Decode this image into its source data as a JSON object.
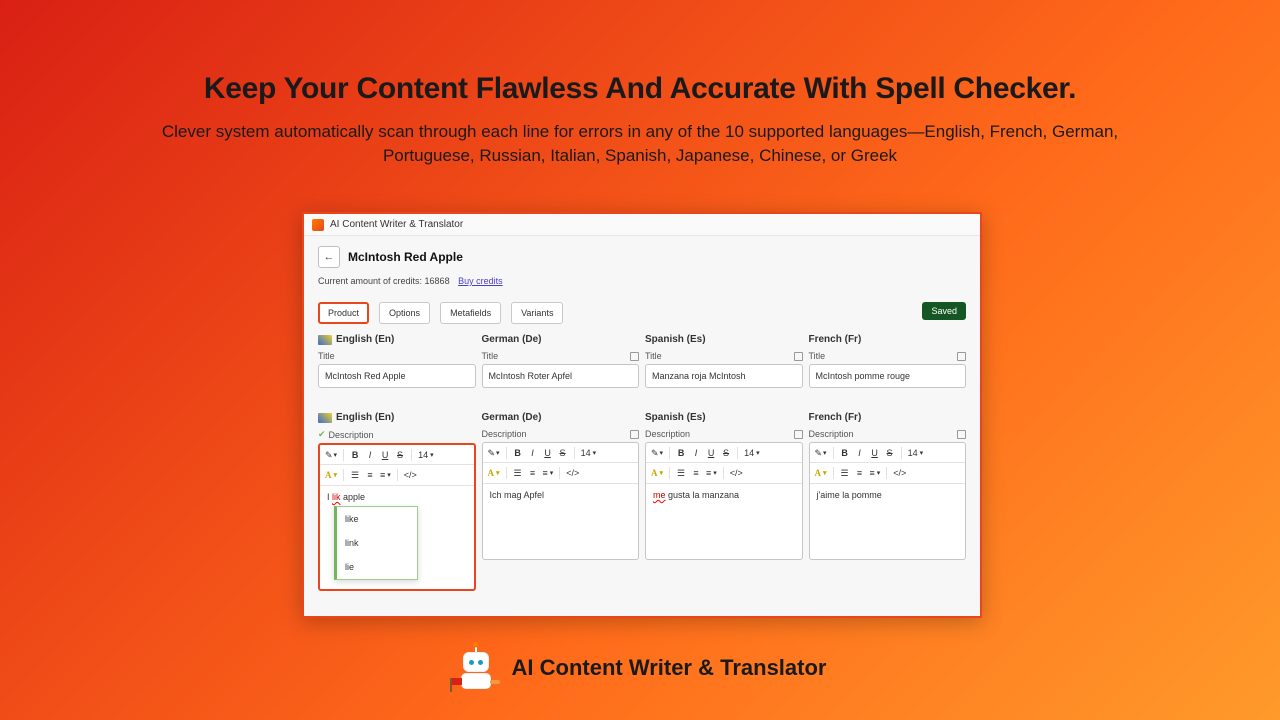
{
  "hero": {
    "title": "Keep Your Content Flawless And Accurate With Spell Checker.",
    "subtitle": "Clever system automatically scan through each line for errors in any of the 10 supported languages—English, French, German, Portuguese, Russian, Italian, Spanish, Japanese, Chinese, or Greek"
  },
  "window": {
    "app_title": "AI Content Writer & Translator",
    "product_name": "McIntosh Red Apple",
    "credits_text": "Current amount of credits: 16868",
    "buy_credits": "Buy credits"
  },
  "tabs": {
    "product": "Product",
    "options": "Options",
    "metafields": "Metafields",
    "variants": "Variants"
  },
  "saved_badge": "Saved",
  "field_labels": {
    "title": "Title",
    "description": "Description"
  },
  "langs": {
    "en": {
      "head": "English (En)",
      "title": "McIntosh Red Apple"
    },
    "de": {
      "head": "German (De)",
      "title": "McIntosh Roter Apfel",
      "desc": "Ich mag Apfel"
    },
    "es": {
      "head": "Spanish (Es)",
      "title": "Manzana roja McIntosh",
      "desc_prefix": "me",
      "desc_rest": " gusta la manzana"
    },
    "fr": {
      "head": "French (Fr)",
      "title": "McIntosh pomme rouge",
      "desc": "j'aime la pomme"
    }
  },
  "editor_font_size": "14",
  "en_desc": {
    "before": "I ",
    "error": "lik",
    "after": " apple"
  },
  "spell_suggestions": [
    "like",
    "link",
    "lie"
  ],
  "brand_name": "AI Content Writer & Translator"
}
